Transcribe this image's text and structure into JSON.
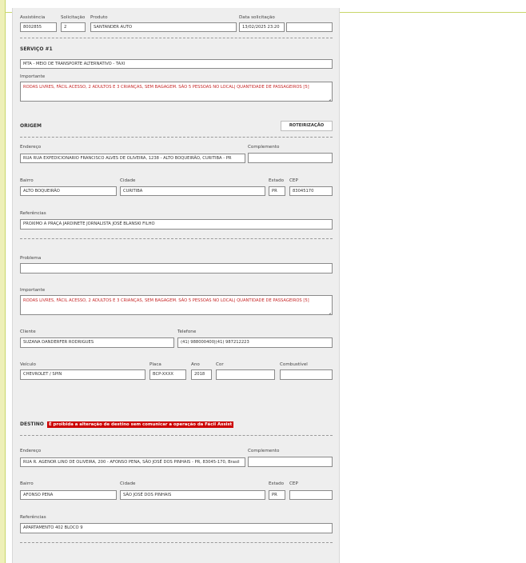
{
  "request": {
    "assistencia_label": "Assistência",
    "assistencia_value": "8002855",
    "solicitacao_label": "Solicitação",
    "solicitacao_value": "2",
    "produto_label": "Produto",
    "produto_value": "SANTANDER AUTO",
    "data_label": "Data solicitação",
    "data_value": "13/02/2025 23:20",
    "extra_value": ""
  },
  "servico": {
    "title": "SERVIÇO #1",
    "tipo_value": "MTA - MEIO DE TRANSPORTE ALTERNATIVO - TAXI",
    "importante_label": "Importante",
    "importante_value": "RODAS LIVRES, FÁCIL ACESSO, 2 ADULTOS E 3 CRIANÇAS, SEM BAGAGEM. SÃO 5 PESSOAS NO LOCAL| QUANTIDADE DE PASSAGEIROS [5]"
  },
  "origem": {
    "title": "ORIGEM",
    "route_button": "ROTEIRIZAÇÃO",
    "endereco_label": "Endereço",
    "endereco_value": "RUA RUA EXPEDICIONARIO FRANCISCO ALVES DE OLIVEIRA, 1238 - ALTO BOQUEIRÃO, CURITIBA - PR",
    "complemento_label": "Complemento",
    "complemento_value": "",
    "bairro_label": "Bairro",
    "bairro_value": "ALTO BOQUEIRÃO",
    "cidade_label": "Cidade",
    "cidade_value": "CURITIBA",
    "estado_label": "Estado",
    "estado_value": "PR",
    "cep_label": "CEP",
    "cep_value": "83045170",
    "referencias_label": "Referências",
    "referencias_value": "PROXIMO A PRAÇA JARDINETE JORNALISTA JOSÉ BLANSKI FILHO"
  },
  "detalhes": {
    "problema_label": "Problema",
    "problema_value": "",
    "importante_label": "Importante",
    "importante_value": "RODAS LIVRES, FÁCIL ACESSO, 2 ADULTOS E 3 CRIANÇAS, SEM BAGAGEM. SÃO 5 PESSOAS NO LOCAL| QUANTIDADE DE PASSAGEIROS [5]",
    "cliente_label": "Cliente",
    "cliente_value": "SUZANA DANDERFER RODRIGUES",
    "telefone_label": "Telefone",
    "telefone_value": "(41) 988000400|(41) 987212223",
    "veiculo_label": "Veículo",
    "veiculo_value": "CHEVROLET / SPIN",
    "placa_label": "Placa",
    "placa_value": "BCP-XXXX",
    "ano_label": "Ano",
    "ano_value": "2018",
    "cor_label": "Cor",
    "cor_value": "",
    "combustivel_label": "Combustível",
    "combustivel_value": ""
  },
  "destino": {
    "title": "DESTINO",
    "warning": "É proibida a alteração de destino sem comunicar a operação da Fácil Assist",
    "endereco_label": "Endereço",
    "endereco_value": "RUA R. AGENOR LINO DE OLIVEIRA, 200 - AFONSO PENA, SÃO JOSÉ DOS PINHAIS - PR, 83045-170, Brasil",
    "complemento_label": "Complemento",
    "complemento_value": "",
    "bairro_label": "Bairro",
    "bairro_value": "AFONSO PENA",
    "cidade_label": "Cidade",
    "cidade_value": "SÃO JOSÉ DOS PINHAIS",
    "estado_label": "Estado",
    "estado_value": "PR",
    "cep_label": "CEP",
    "cep_value": "",
    "referencias_label": "Referências",
    "referencias_value": "APARTAMENTO 402 BLOCO 9"
  },
  "colors": {
    "warning": "#cc0000",
    "important_text": "#c62828",
    "panel": "#eeeeee"
  }
}
